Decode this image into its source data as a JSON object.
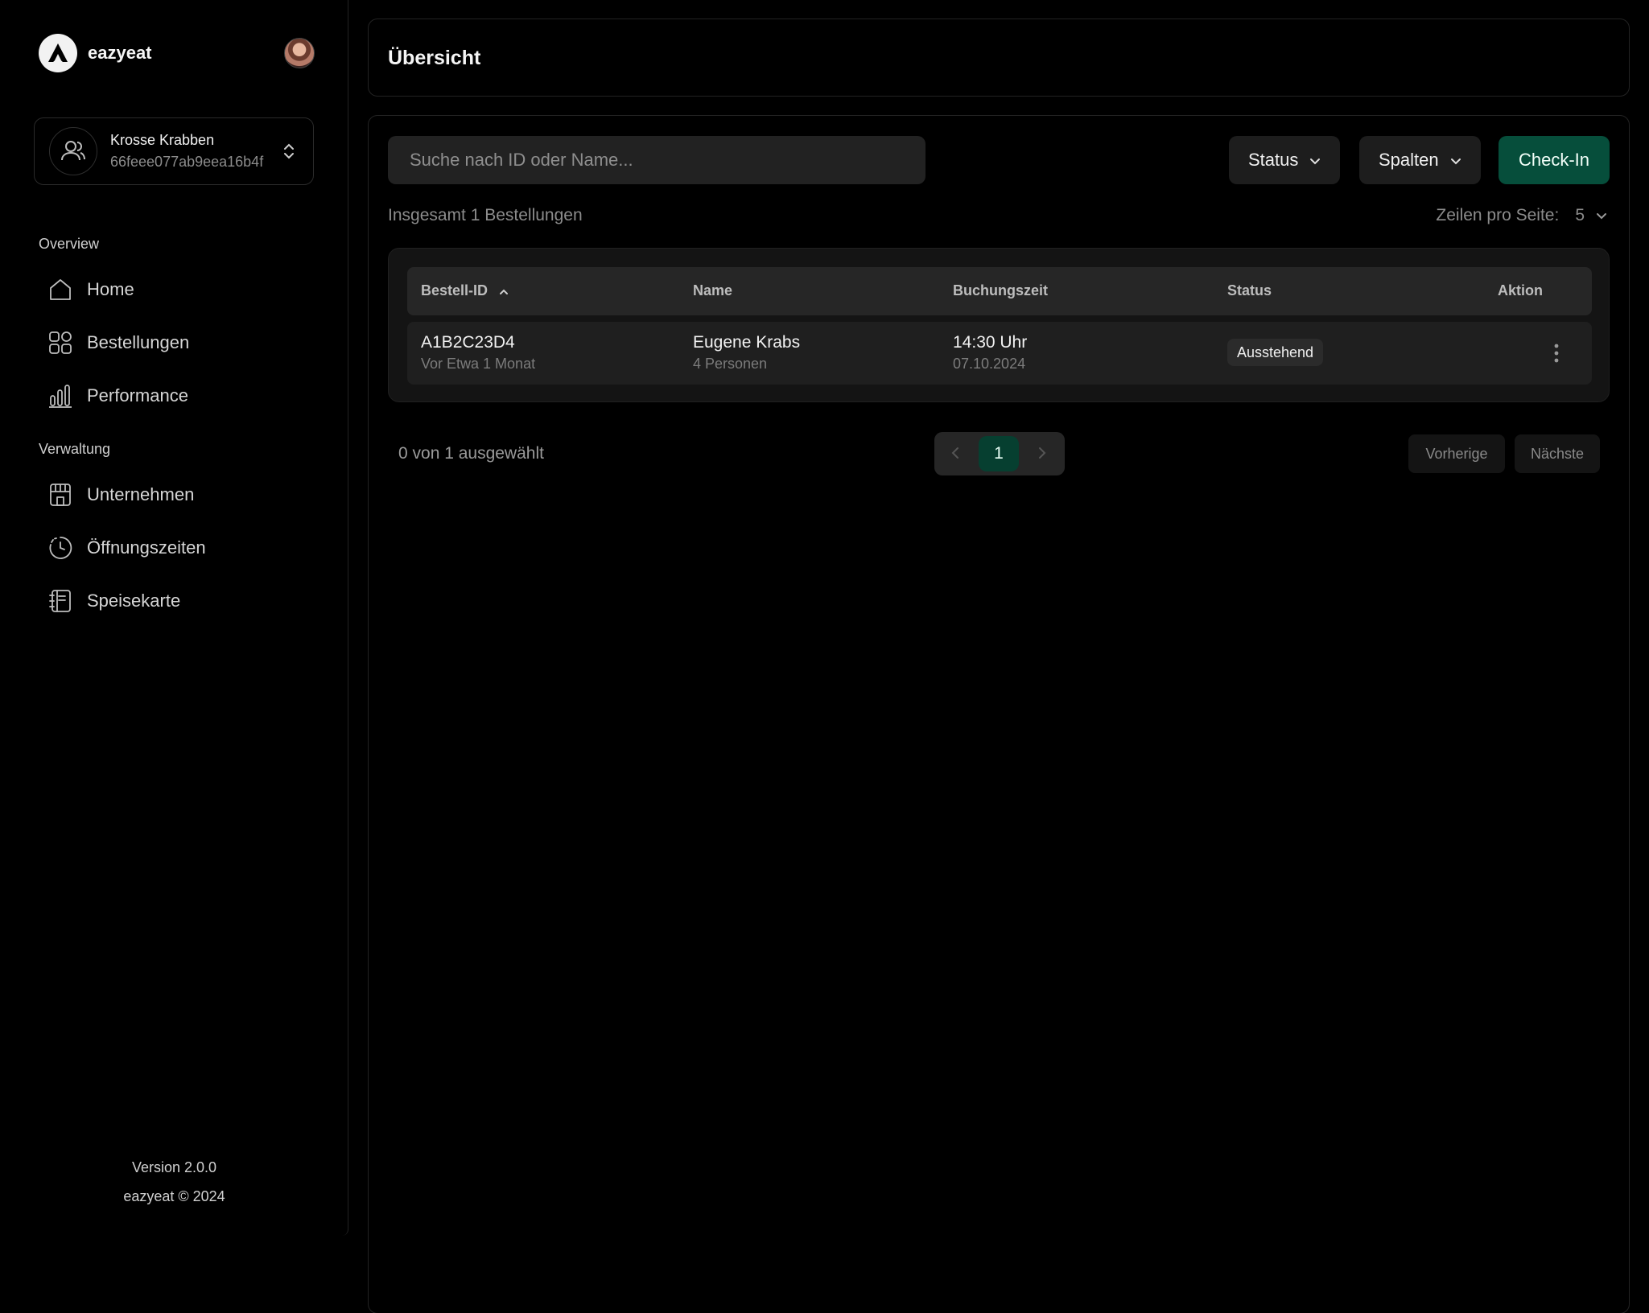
{
  "brand": {
    "name": "eazyeat"
  },
  "company": {
    "name": "Krosse Krabben",
    "id": "66feee077ab9eea16b4f"
  },
  "sidebar": {
    "sections": [
      {
        "title": "Overview",
        "items": [
          {
            "label": "Home",
            "icon": "home-icon"
          },
          {
            "label": "Bestellungen",
            "icon": "grid-icon"
          },
          {
            "label": "Performance",
            "icon": "bar-chart-icon"
          }
        ]
      },
      {
        "title": "Verwaltung",
        "items": [
          {
            "label": "Unternehmen",
            "icon": "store-icon"
          },
          {
            "label": "Öffnungszeiten",
            "icon": "clock-icon"
          },
          {
            "label": "Speisekarte",
            "icon": "menu-book-icon"
          }
        ]
      }
    ]
  },
  "footer": {
    "version": "Version 2.0.0",
    "copyright": "eazyeat © 2024"
  },
  "header": {
    "title": "Übersicht"
  },
  "toolbar": {
    "search_placeholder": "Suche nach ID oder Name...",
    "status_label": "Status",
    "columns_label": "Spalten",
    "checkin_label": "Check-In"
  },
  "summary": {
    "total": "Insgesamt 1 Bestellungen",
    "rows_per_page_label": "Zeilen pro Seite:",
    "rows_per_page_value": "5"
  },
  "table": {
    "columns": [
      "Bestell-ID",
      "Name",
      "Buchungszeit",
      "Status",
      "Aktion"
    ],
    "rows": [
      {
        "id": "A1B2C23D4",
        "id_sub": "Vor Etwa 1 Monat",
        "name": "Eugene Krabs",
        "name_sub": "4 Personen",
        "time": "14:30 Uhr",
        "date": "07.10.2024",
        "status": "Ausstehend"
      }
    ]
  },
  "pagination": {
    "selected": "0 von 1 ausgewählt",
    "current_page": "1",
    "prev_label": "Vorherige",
    "next_label": "Nächste"
  },
  "colors": {
    "background": "#000000",
    "accent": "#064e3b",
    "border": "#232323"
  }
}
